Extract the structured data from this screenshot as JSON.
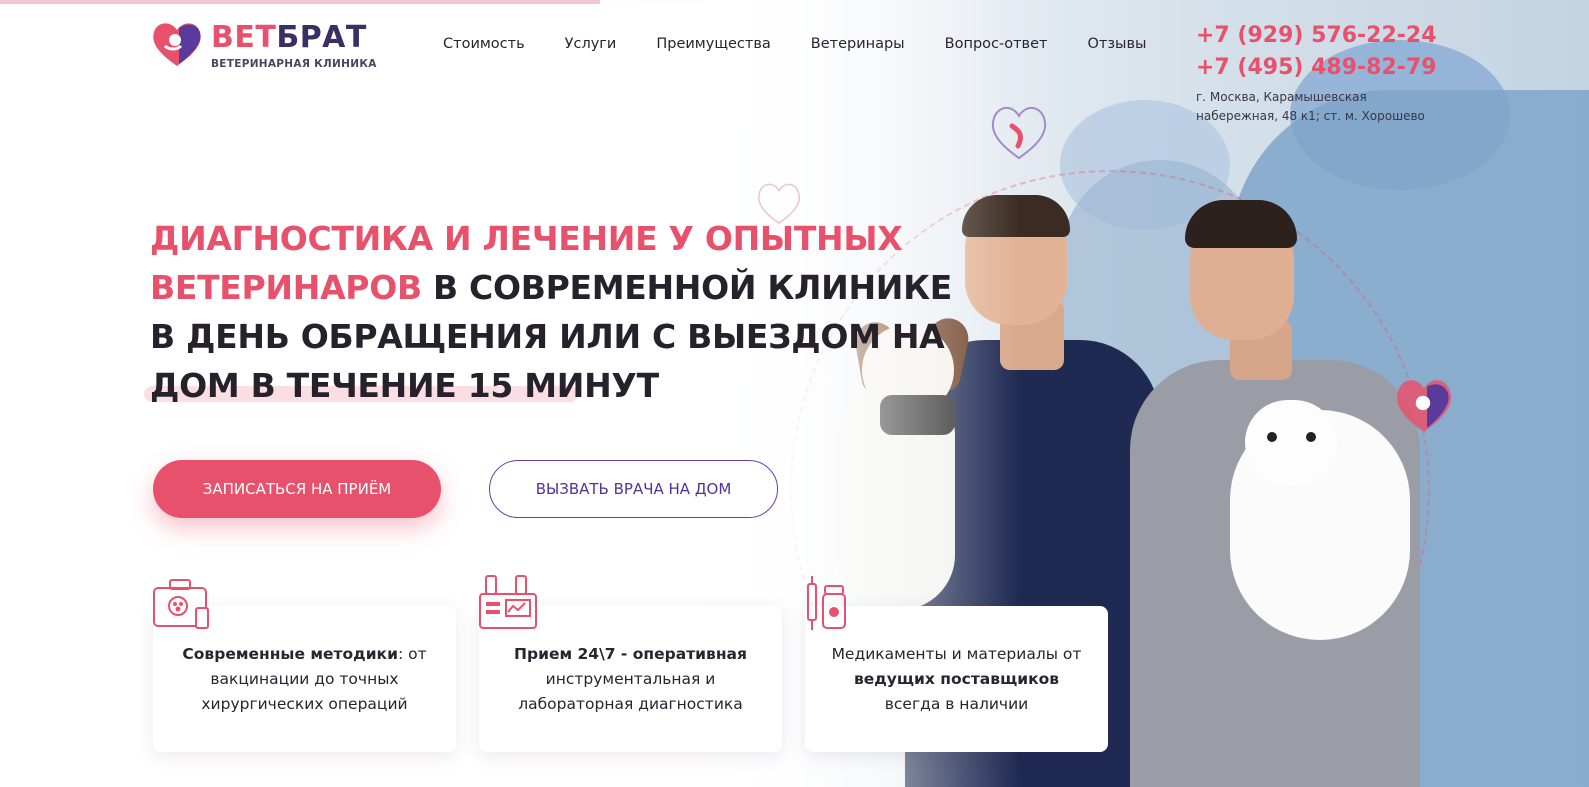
{
  "logo": {
    "brand_part1": "ВЕТ",
    "brand_part2": "БРАТ",
    "subtitle": "ВЕТЕРИНАРНАЯ КЛИНИКА"
  },
  "nav": [
    {
      "label": "Стоимость"
    },
    {
      "label": "Услуги"
    },
    {
      "label": "Преимущества"
    },
    {
      "label": "Ветеринары"
    },
    {
      "label": "Вопрос-ответ"
    },
    {
      "label": "Отзывы"
    }
  ],
  "contacts": {
    "phone1": "+7 (929) 576-22-24",
    "phone2": "+7 (495) 489-82-79",
    "address_line1": "г. Москва, Карамышевская",
    "address_line2": "набережная, 48 к1; ст. м. Хорошево"
  },
  "hero": {
    "line1": "ДИАГНОСТИКА И ЛЕЧЕНИЕ У ОПЫТНЫХ",
    "line2_accent": "ВЕТЕРИНАРОВ",
    "line2_rest": " В СОВРЕМЕННОЙ КЛИНИКЕ",
    "line3": "В ДЕНЬ ОБРАЩЕНИЯ ИЛИ С ВЫЕЗДОМ НА",
    "line4": "ДОМ В ТЕЧЕНИЕ 15 МИНУТ"
  },
  "buttons": {
    "appointment": "ЗАПИСАТЬСЯ НА ПРИЁМ",
    "home_visit": "ВЫЗВАТЬ ВРАЧА НА ДОМ"
  },
  "cards": [
    {
      "bold": "Современные методики",
      "text": ": от вакцинации до точных хирургических операций",
      "icon": "first-aid-kit-icon"
    },
    {
      "bold": "Прием 24\\7 - оперативная",
      "text": " инструментальная и лабораторная диагностика",
      "icon": "lab-equipment-icon"
    },
    {
      "pre": "Медикаменты и материалы от ",
      "bold": "ведущих поставщиков",
      "text": " всегда в наличии",
      "icon": "medicine-syringe-icon"
    }
  ],
  "colors": {
    "accent": "#e8516b",
    "brand_dark": "#3a2e63",
    "outline_purple": "#6a3fb0",
    "text": "#2a2330"
  }
}
